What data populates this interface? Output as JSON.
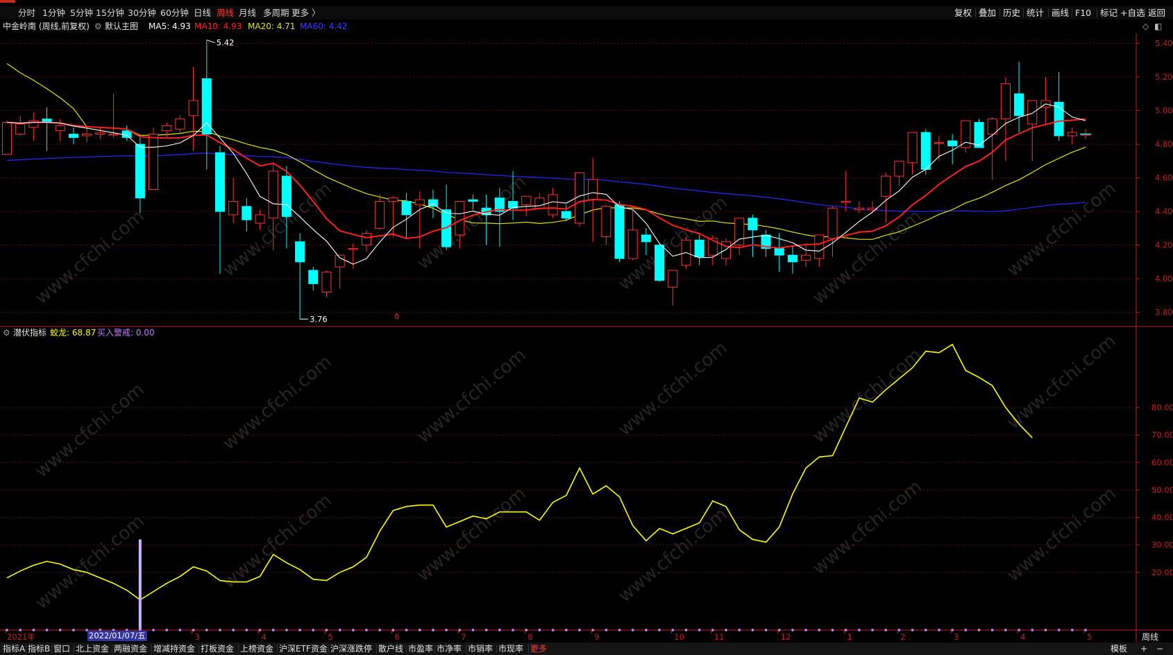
{
  "periods": {
    "items": [
      "分时",
      "1分钟",
      "5分钟",
      "15分钟",
      "30分钟",
      "60分钟",
      "日线",
      "周线",
      "月线",
      "多周期",
      "更多 〉"
    ],
    "active": "周线"
  },
  "tools": [
    "复权",
    "叠加",
    "历史",
    "统计",
    "画线",
    "F10",
    "标记",
    "+自选",
    "返回"
  ],
  "chart_header": {
    "stock": "中金岭南 (周线,前复权)",
    "template": "默认主图",
    "ma5": "MA5: 4.93",
    "ma10": "MA10: 4.93",
    "ma20": "MA20: 4.71",
    "ma60": "MA60: 4.42"
  },
  "indicator_header": {
    "name": "潜伏指标",
    "jiaolong": "蛟龙: 68.87",
    "buy_alert": "买入警戒: 0.00"
  },
  "price_labels": {
    "high": "5.42",
    "low": "3.76",
    "marker": "δ"
  },
  "cursor_date": "2022/01/07/五",
  "bottom_tabs": [
    "指标A",
    "指标B",
    "窗口",
    "北上资金",
    "两融资金",
    "增减持资金",
    "打板资金",
    "上榜资金",
    "沪深ETF资金",
    "沪深涨跌停",
    "散户线",
    "市盈率",
    "市净率",
    "市销率",
    "市现率",
    "更多"
  ],
  "bottom_right": [
    "模板",
    "+",
    "−"
  ],
  "period_label_right": "周线",
  "watermark": "www.cfchi.com",
  "colors": {
    "up": "#ff3232",
    "down": "#00ffff",
    "ma5": "#ffffff",
    "ma10": "#ff2020",
    "ma20": "#e6e600",
    "ma60": "#2828ff",
    "indicator": "#ffff00",
    "axis": "#c81e1e"
  },
  "chart_data": [
    {
      "type": "candlestick",
      "title": "中金岭南 (周线,前复权)",
      "y_ticks": [
        5.4,
        5.2,
        5.0,
        4.8,
        4.6,
        4.4,
        4.2,
        4.0,
        3.8
      ],
      "ylim": [
        3.72,
        5.46
      ],
      "x_ticks": [
        "2021年",
        "2022/01/07/五",
        "3",
        "4",
        "5",
        "6",
        "7",
        "8",
        "9",
        "10",
        "11",
        "12",
        "1",
        "2",
        "3",
        "4",
        "5"
      ],
      "x_tick_index": [
        0,
        10,
        14,
        19,
        24,
        29,
        34,
        39,
        44,
        50,
        53,
        58,
        63,
        67,
        71,
        76,
        81
      ],
      "candles": [
        [
          4.74,
          4.94,
          4.75,
          4.93
        ],
        [
          4.86,
          4.97,
          4.85,
          4.92
        ],
        [
          4.9,
          4.99,
          4.82,
          4.94
        ],
        [
          4.95,
          5.02,
          4.76,
          4.93
        ],
        [
          4.88,
          4.95,
          4.82,
          4.91
        ],
        [
          4.86,
          4.9,
          4.8,
          4.84
        ],
        [
          4.85,
          4.91,
          4.81,
          4.86
        ],
        [
          4.86,
          4.9,
          4.83,
          4.87
        ],
        [
          4.86,
          5.1,
          4.84,
          4.86
        ],
        [
          4.88,
          4.91,
          4.82,
          4.84
        ],
        [
          4.8,
          4.84,
          4.39,
          4.48
        ],
        [
          4.53,
          4.9,
          4.53,
          4.86
        ],
        [
          4.88,
          4.93,
          4.84,
          4.91
        ],
        [
          4.89,
          4.97,
          4.86,
          4.95
        ],
        [
          4.97,
          5.26,
          4.76,
          5.06
        ],
        [
          5.19,
          5.42,
          4.65,
          4.86
        ],
        [
          4.75,
          4.79,
          4.03,
          4.4
        ],
        [
          4.38,
          4.6,
          4.33,
          4.46
        ],
        [
          4.43,
          4.48,
          4.28,
          4.35
        ],
        [
          4.33,
          4.41,
          4.29,
          4.38
        ],
        [
          4.36,
          4.69,
          4.17,
          4.64
        ],
        [
          4.61,
          4.67,
          4.18,
          4.37
        ],
        [
          4.22,
          4.27,
          3.76,
          4.1
        ],
        [
          4.05,
          4.07,
          3.93,
          3.97
        ],
        [
          3.92,
          4.05,
          3.89,
          4.04
        ],
        [
          4.07,
          4.11,
          3.94,
          4.14
        ],
        [
          4.18,
          4.21,
          4.06,
          4.18
        ],
        [
          4.2,
          4.29,
          4.16,
          4.27
        ],
        [
          4.3,
          4.5,
          4.29,
          4.46
        ],
        [
          4.46,
          4.49,
          4.25,
          4.48
        ],
        [
          4.46,
          4.51,
          4.24,
          4.38
        ],
        [
          4.44,
          4.52,
          4.18,
          4.47
        ],
        [
          4.47,
          4.53,
          4.36,
          4.43
        ],
        [
          4.41,
          4.56,
          4.17,
          4.19
        ],
        [
          4.26,
          4.44,
          4.18,
          4.46
        ],
        [
          4.47,
          4.5,
          4.41,
          4.46
        ],
        [
          4.42,
          4.5,
          4.2,
          4.38
        ],
        [
          4.48,
          4.54,
          4.19,
          4.4
        ],
        [
          4.46,
          4.64,
          4.35,
          4.42
        ],
        [
          4.44,
          4.49,
          4.37,
          4.49
        ],
        [
          4.42,
          4.51,
          4.41,
          4.48
        ],
        [
          4.38,
          4.54,
          4.36,
          4.5
        ],
        [
          4.4,
          4.44,
          4.34,
          4.36
        ],
        [
          4.33,
          4.61,
          4.31,
          4.63
        ],
        [
          4.47,
          4.72,
          4.22,
          4.59
        ],
        [
          4.25,
          4.44,
          4.2,
          4.43
        ],
        [
          4.44,
          4.46,
          4.1,
          4.12
        ],
        [
          4.12,
          4.41,
          4.11,
          4.29
        ],
        [
          4.26,
          4.3,
          4.14,
          4.22
        ],
        [
          4.2,
          4.21,
          3.98,
          3.99
        ],
        [
          3.95,
          4.04,
          3.84,
          4.05
        ],
        [
          4.08,
          4.25,
          4.06,
          4.23
        ],
        [
          4.23,
          4.26,
          4.08,
          4.13
        ],
        [
          4.14,
          4.26,
          4.08,
          4.24
        ],
        [
          4.12,
          4.24,
          4.08,
          4.22
        ],
        [
          4.2,
          4.28,
          4.14,
          4.36
        ],
        [
          4.36,
          4.38,
          4.13,
          4.29
        ],
        [
          4.26,
          4.29,
          4.13,
          4.18
        ],
        [
          4.18,
          4.27,
          4.04,
          4.14
        ],
        [
          4.14,
          4.2,
          4.03,
          4.1
        ],
        [
          4.11,
          4.21,
          4.07,
          4.14
        ],
        [
          4.12,
          4.26,
          4.07,
          4.26
        ],
        [
          4.24,
          4.43,
          4.13,
          4.42
        ],
        [
          4.46,
          4.64,
          4.4,
          4.46
        ],
        [
          4.41,
          4.46,
          4.39,
          4.42
        ],
        [
          4.41,
          4.46,
          4.39,
          4.42
        ],
        [
          4.49,
          4.63,
          4.33,
          4.61
        ],
        [
          4.61,
          4.68,
          4.55,
          4.7
        ],
        [
          4.69,
          4.87,
          4.62,
          4.87
        ],
        [
          4.87,
          4.89,
          4.62,
          4.65
        ],
        [
          4.81,
          4.85,
          4.7,
          4.81
        ],
        [
          4.82,
          4.86,
          4.68,
          4.79
        ],
        [
          4.78,
          4.93,
          4.75,
          4.94
        ],
        [
          4.93,
          4.95,
          4.78,
          4.78
        ],
        [
          4.86,
          4.96,
          4.59,
          4.95
        ],
        [
          4.95,
          5.2,
          4.7,
          5.16
        ],
        [
          5.1,
          5.29,
          4.87,
          4.97
        ],
        [
          4.92,
          5.0,
          4.7,
          5.06
        ],
        [
          5.02,
          5.2,
          4.91,
          5.06
        ],
        [
          5.05,
          5.23,
          4.82,
          4.85
        ],
        [
          4.85,
          4.9,
          4.8,
          4.87
        ],
        [
          4.86,
          4.89,
          4.83,
          4.86
        ]
      ]
    },
    {
      "type": "line",
      "title": "潜伏指标",
      "series_name": "蛟龙",
      "y_ticks": [
        80.0,
        70.0,
        60.0,
        50.0,
        40.0,
        30.0,
        20.0
      ],
      "ylim": [
        0,
        106
      ],
      "values": [
        18,
        20.5,
        22.6,
        24,
        23,
        21,
        20,
        18,
        16,
        13.5,
        10,
        13,
        16,
        18.5,
        22,
        20.5,
        17,
        16.5,
        16.5,
        18.5,
        26.5,
        23.5,
        21,
        17.5,
        17,
        20,
        22,
        25.5,
        35,
        42.5,
        44,
        44.5,
        44.5,
        36.5,
        38.5,
        40.5,
        39.5,
        42,
        42,
        42,
        39,
        45.5,
        48,
        58,
        48.5,
        51.5,
        47.5,
        37,
        31.5,
        36,
        34,
        36,
        38,
        46,
        44,
        35.5,
        32,
        31,
        36.5,
        48.5,
        58,
        62,
        62.5,
        73,
        83.5,
        82,
        86.5,
        90.5,
        94.5,
        100.5,
        100,
        103,
        93.5,
        91,
        88,
        80,
        74,
        69
      ]
    }
  ]
}
